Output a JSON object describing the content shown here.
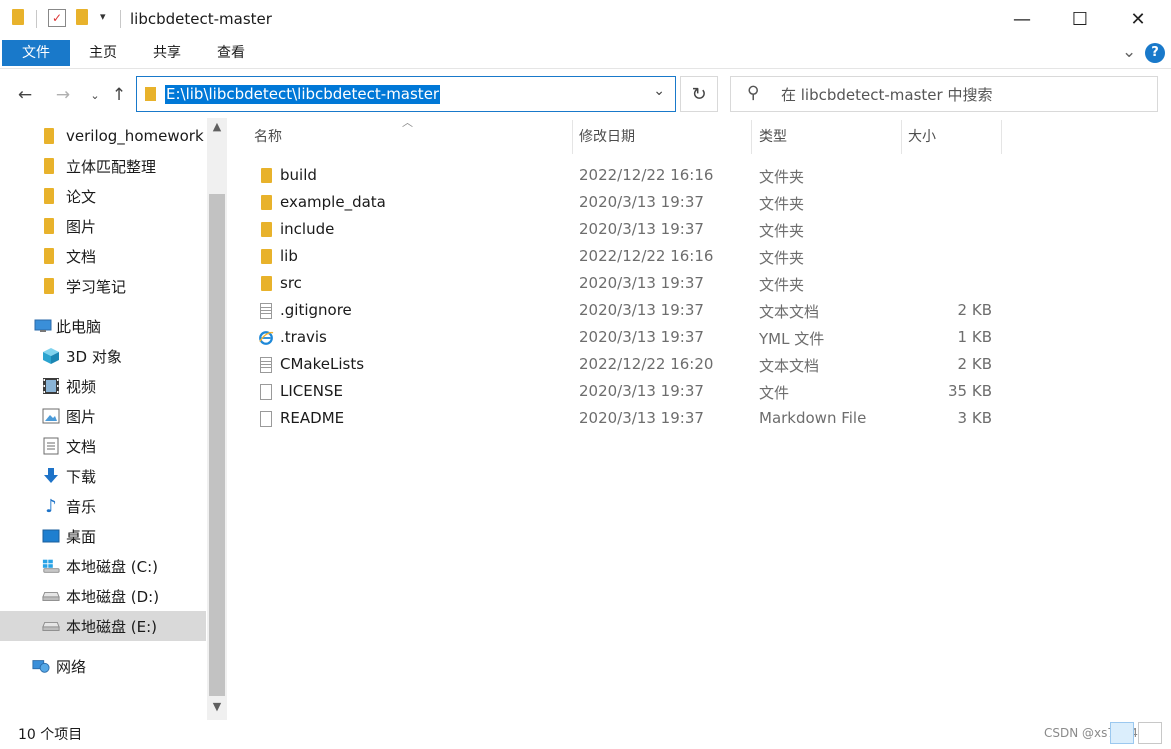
{
  "window": {
    "title": "libcbdetect-master",
    "minimize_glyph": "—",
    "maximize_glyph": "☐",
    "close_glyph": "✕"
  },
  "ribbon": {
    "tabs": [
      "文件",
      "主页",
      "共享",
      "查看"
    ],
    "expand_glyph": "⌄",
    "help_glyph": "?"
  },
  "addressbar": {
    "path": "E:\\lib\\libcbdetect\\libcbdetect-master",
    "search_placeholder": "在 libcbdetect-master 中搜索"
  },
  "nav_pane": {
    "items": [
      {
        "label": "verilog_homework",
        "icon": "folder-icon"
      },
      {
        "label": "立体匹配整理",
        "icon": "folder-icon"
      },
      {
        "label": "论文",
        "icon": "folder-icon"
      },
      {
        "label": "图片",
        "icon": "folder-icon"
      },
      {
        "label": "文档",
        "icon": "folder-icon"
      },
      {
        "label": "学习笔记",
        "icon": "folder-icon"
      },
      {
        "label": "此电脑",
        "icon": "computer-icon"
      },
      {
        "label": "3D 对象",
        "icon": "3d-objects-icon"
      },
      {
        "label": "视频",
        "icon": "video-icon"
      },
      {
        "label": "图片",
        "icon": "pictures-icon"
      },
      {
        "label": "文档",
        "icon": "documents-icon"
      },
      {
        "label": "下载",
        "icon": "download-icon"
      },
      {
        "label": "音乐",
        "icon": "music-icon"
      },
      {
        "label": "桌面",
        "icon": "desktop-icon"
      },
      {
        "label": "本地磁盘 (C:)",
        "icon": "windows-drive-icon"
      },
      {
        "label": "本地磁盘 (D:)",
        "icon": "drive-icon"
      },
      {
        "label": "本地磁盘 (E:)",
        "icon": "drive-icon",
        "selected": true
      },
      {
        "label": "网络",
        "icon": "network-icon"
      }
    ]
  },
  "columns": {
    "name": "名称",
    "date": "修改日期",
    "type": "类型",
    "size": "大小"
  },
  "files": [
    {
      "name": "build",
      "date": "2022/12/22 16:16",
      "type": "文件夹",
      "size": "",
      "icon": "folder-icon"
    },
    {
      "name": "example_data",
      "date": "2020/3/13 19:37",
      "type": "文件夹",
      "size": "",
      "icon": "folder-icon"
    },
    {
      "name": "include",
      "date": "2020/3/13 19:37",
      "type": "文件夹",
      "size": "",
      "icon": "folder-icon"
    },
    {
      "name": "lib",
      "date": "2022/12/22 16:16",
      "type": "文件夹",
      "size": "",
      "icon": "folder-icon"
    },
    {
      "name": "src",
      "date": "2020/3/13 19:37",
      "type": "文件夹",
      "size": "",
      "icon": "folder-icon"
    },
    {
      "name": ".gitignore",
      "date": "2020/3/13 19:37",
      "type": "文本文档",
      "size": "2 KB",
      "icon": "text-file-icon"
    },
    {
      "name": ".travis",
      "date": "2020/3/13 19:37",
      "type": "YML 文件",
      "size": "1 KB",
      "icon": "ie-file-icon"
    },
    {
      "name": "CMakeLists",
      "date": "2022/12/22 16:20",
      "type": "文本文档",
      "size": "2 KB",
      "icon": "text-file-icon"
    },
    {
      "name": "LICENSE",
      "date": "2020/3/13 19:37",
      "type": "文件",
      "size": "35 KB",
      "icon": "blank-file-icon"
    },
    {
      "name": "README",
      "date": "2020/3/13 19:37",
      "type": "Markdown File",
      "size": "3 KB",
      "icon": "blank-file-icon"
    }
  ],
  "status": {
    "item_count": "10 个项目",
    "watermark": "CSDN @xs7814365"
  },
  "colors": {
    "accent": "#1979ca",
    "selection": "#0078d7",
    "folder": "#e8b22b"
  }
}
